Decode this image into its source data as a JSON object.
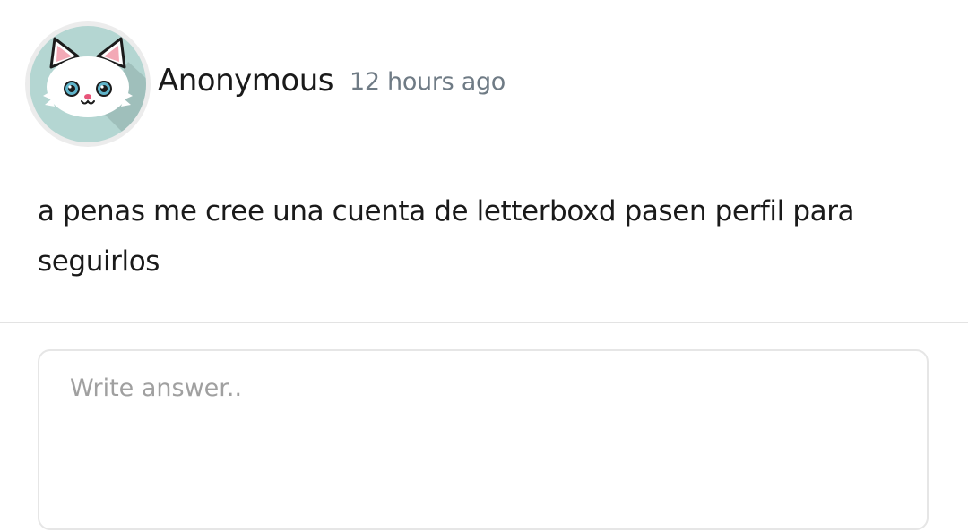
{
  "post": {
    "author": "Anonymous",
    "time": "12 hours ago",
    "avatar_icon": "white-cat-face-icon",
    "text": "a penas me cree una cuenta de letterboxd pasen perfil para seguirlos"
  },
  "answer": {
    "placeholder": "Write answer.."
  },
  "colors": {
    "avatar_bg": "#b4d6d2",
    "avatar_ring": "#ececec",
    "timestamp": "#6f7b85",
    "divider": "#e3e3e3"
  }
}
